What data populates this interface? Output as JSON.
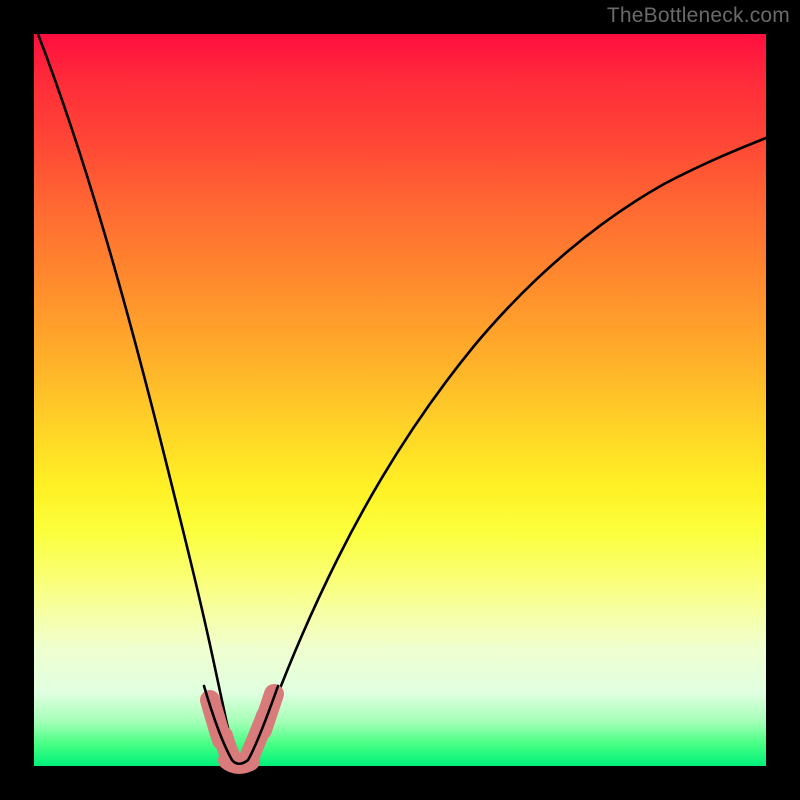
{
  "watermark": "TheBottleneck.com",
  "chart_data": {
    "type": "line",
    "title": "",
    "xlabel": "",
    "ylabel": "",
    "xlim": [
      0,
      100
    ],
    "ylim": [
      0,
      100
    ],
    "series": [
      {
        "name": "bottleneck-curve",
        "x": [
          0,
          5,
          10,
          14,
          18,
          20,
          22,
          24,
          25,
          26,
          27,
          28,
          29,
          30,
          32,
          34,
          38,
          44,
          52,
          62,
          74,
          88,
          100
        ],
        "values": [
          100,
          80,
          58,
          40,
          22,
          14,
          8,
          4,
          2,
          1,
          0.5,
          1,
          2,
          4,
          8,
          14,
          24,
          36,
          48,
          58,
          66,
          73,
          78
        ]
      }
    ],
    "annotations": {
      "highlight_region": {
        "x_start": 23,
        "x_end": 29,
        "color": "#d97b7b"
      }
    }
  }
}
